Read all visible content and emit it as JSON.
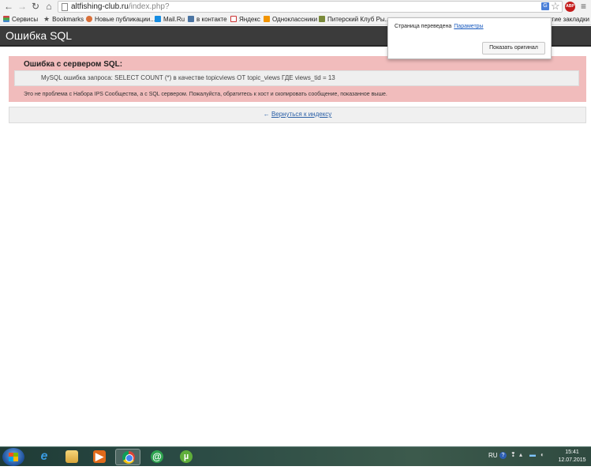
{
  "browser": {
    "url_host": "altfishing-club.ru",
    "url_path": "/index.php?",
    "bookmarks": [
      {
        "label": "Сервисы"
      },
      {
        "label": "Bookmarks"
      },
      {
        "label": "Новые публикации..."
      },
      {
        "label": "Mail.Ru"
      },
      {
        "label": "в контакте"
      },
      {
        "label": "Яндекс"
      },
      {
        "label": "Одноклассники"
      },
      {
        "label": "Питерский Клуб Ры..."
      }
    ],
    "other_bookmarks": "угие закладки",
    "translate_popup": {
      "message": "Страница переведена",
      "params_link": "Параметры",
      "show_original_button": "Показать оригинал"
    },
    "icons": {
      "back": "back-arrow-icon",
      "forward": "forward-arrow-icon",
      "reload": "reload-icon",
      "home": "home-icon",
      "translate": "translate-icon",
      "star": "star-icon",
      "adblock": "ABP",
      "menu": "menu-icon"
    }
  },
  "page": {
    "header_title": "Ошибка SQL",
    "error_title": "Ошибка с сервером SQL:",
    "query_text": "MySQL ошибка запроса: SELECT COUNT (*) в качестве topicviews ОТ topic_views ГДЕ views_tid = 13",
    "note_text": "Это не проблема с Набора IPS Сообщества, а с SQL сервером. Пожалуйста, обратитесь к хост и скопировать сообщение, показанное выше.",
    "back_arrow": "←",
    "back_link": "Вернуться к индексу",
    "colors": {
      "header_bg": "#3b3b3b",
      "error_bg": "#f1bcbc",
      "link": "#2a5fa6"
    }
  },
  "taskbar": {
    "apps": [
      "internet-explorer",
      "windows-explorer",
      "media-player",
      "google-chrome",
      "mail-ru-agent",
      "utorrent"
    ],
    "language": "RU",
    "time": "15:41",
    "date": "12.07.2015"
  }
}
